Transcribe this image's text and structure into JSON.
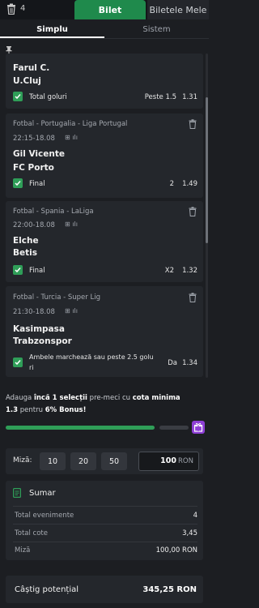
{
  "header": {
    "selection_count": "4",
    "tabs": [
      "Bilet",
      "Biletele Mele"
    ]
  },
  "subtabs": [
    "Simplu",
    "Sistem"
  ],
  "selections": [
    {
      "league": "",
      "time": "",
      "home": "Farul C.",
      "away": "U.Cluj",
      "market": "Total goluri",
      "pick": "Peste 1.5",
      "odd": "1.31"
    },
    {
      "league": "Fotbal - Portugalia - Liga Portugal",
      "time": "22:15-18.08",
      "home": "Gil Vicente",
      "away": "FC Porto",
      "market": "Final",
      "pick": "2",
      "odd": "1.49"
    },
    {
      "league": "Fotbal - Spania - LaLiga",
      "time": "22:00-18.08",
      "home": "Elche",
      "away": "Betis",
      "market": "Final",
      "pick": "X2",
      "odd": "1.32"
    },
    {
      "league": "Fotbal - Turcia - Super Lig",
      "time": "21:30-18.08",
      "home": "Kasimpasa",
      "away": "Trabzonspor",
      "market_line1": "Ambele marchează sau peste 2.5 golu",
      "market_line2": "ri",
      "pick": "Da",
      "odd": "1.34"
    }
  ],
  "bonus": {
    "p1": "Adauga ",
    "b1": "încă 1 selecții",
    "p2": " pre-meci ",
    "p3": "cu ",
    "b2": "cota minima",
    "b3": "1.3",
    "p4": " pentru ",
    "b4": "6% Bonus",
    "p5": "!",
    "progress": 0.81
  },
  "stake": {
    "label": "Miză:",
    "chips": [
      "10",
      "20",
      "50"
    ],
    "value": "100",
    "currency": "RON"
  },
  "summary": {
    "title": "Sumar",
    "rows": [
      {
        "label": "Total evenimente",
        "value": "4"
      },
      {
        "label": "Total cote",
        "value": "3,45"
      },
      {
        "label": "Miză",
        "value": "100,00 RON"
      }
    ]
  },
  "payout": {
    "label": "Câștig potențial",
    "value": "345,25 RON"
  },
  "colors": {
    "accent": "#2f9e58",
    "active_tab": "#1f8a4c",
    "bonus_gift": "#8e3fd6"
  }
}
